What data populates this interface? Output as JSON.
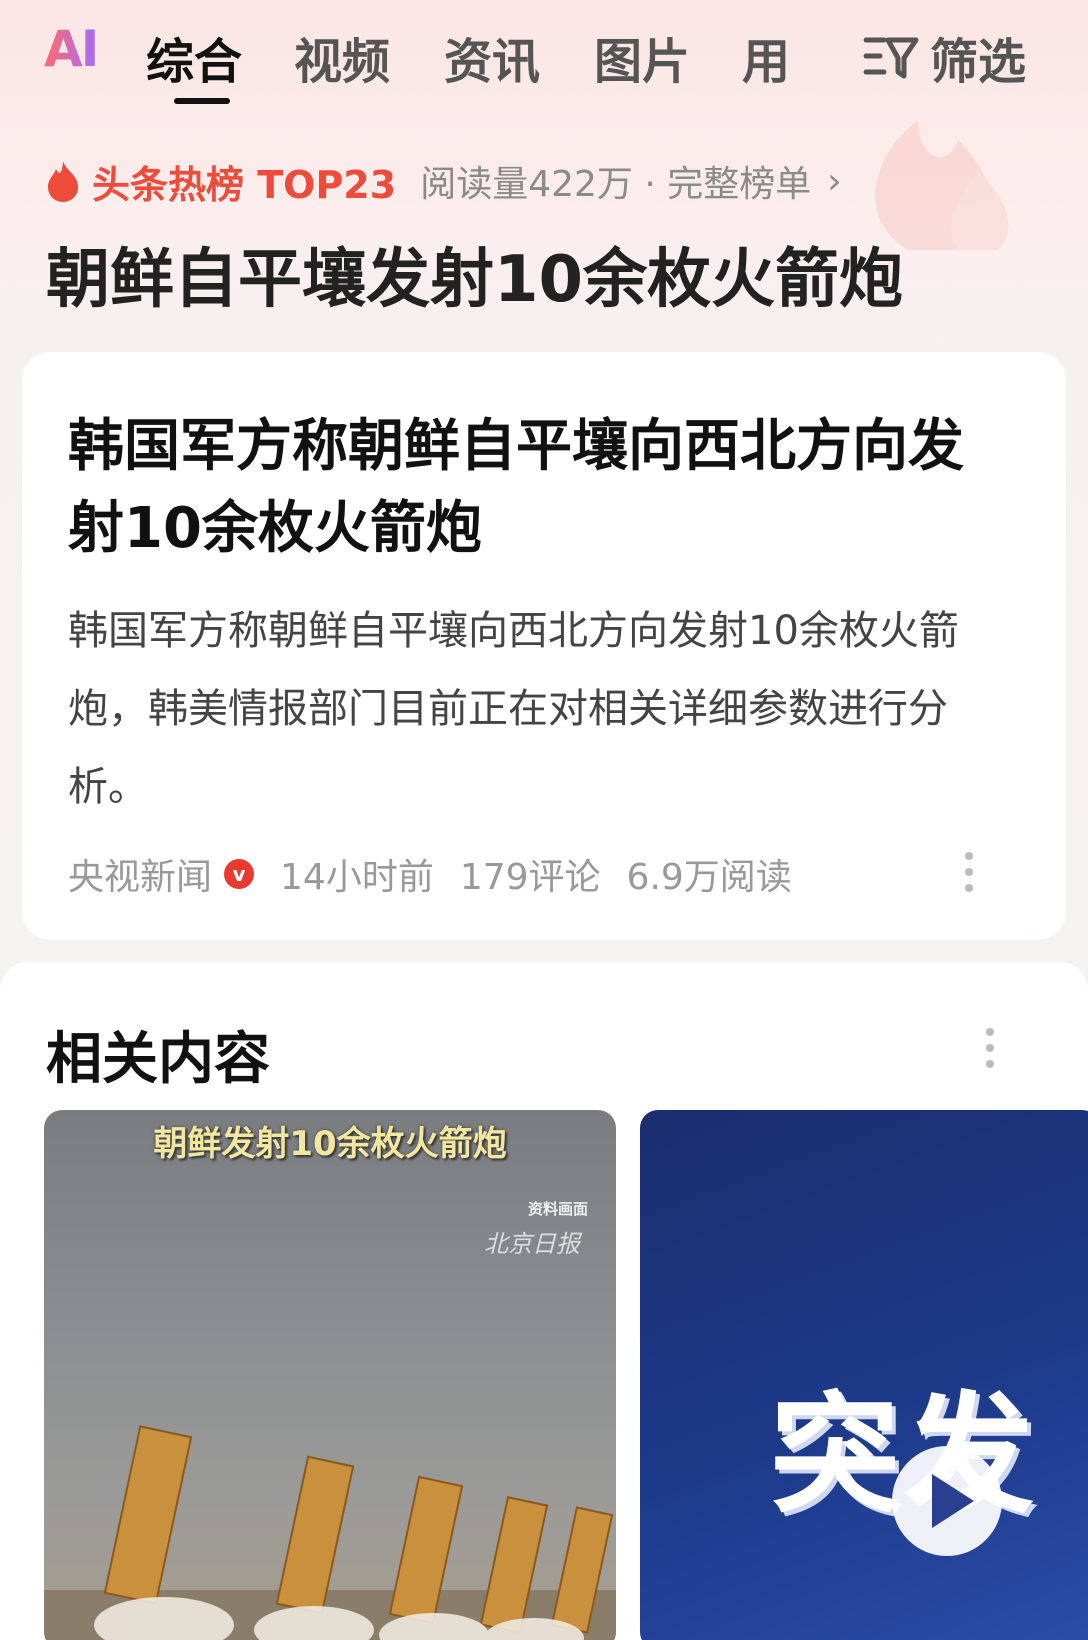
{
  "tabs": {
    "ai_label": "AI",
    "items": [
      {
        "label": "综合",
        "active": true
      },
      {
        "label": "视频",
        "active": false
      },
      {
        "label": "资讯",
        "active": false
      },
      {
        "label": "图片",
        "active": false
      },
      {
        "label": "用",
        "active": false
      }
    ],
    "filter_label": "筛选"
  },
  "hot_list": {
    "label": "头条热榜 TOP23",
    "meta": "阅读量422万 · 完整榜单",
    "chevron": "›",
    "icon": "flame-icon",
    "accent_color": "#ef4b3b"
  },
  "topic_title": "朝鲜自平壤发射10余枚火箭炮",
  "news_card": {
    "title": "韩国军方称朝鲜自平壤向西北方向发射10余枚火箭炮",
    "summary": "韩国军方称朝鲜自平壤向西北方向发射10余枚火箭炮，韩美情报部门目前正在对相关详细参数进行分析。",
    "source": "央视新闻",
    "verified_badge": "v",
    "time": "14小时前",
    "comments": "179评论",
    "reads": "6.9万阅读"
  },
  "related": {
    "title": "相关内容",
    "items": [
      {
        "caption": "朝鲜发射10余枚火箭炮",
        "watermark_top": "资料画面",
        "watermark_bottom": "北京日报"
      },
      {
        "overlay_text": "突发",
        "has_play_button": true
      }
    ]
  }
}
